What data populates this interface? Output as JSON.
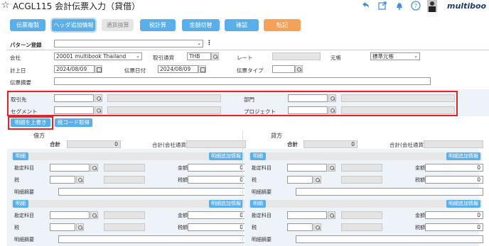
{
  "header": {
    "title": "ACGL115 会計伝票入力（貸借）",
    "logo": "multiboo"
  },
  "toolbar": {
    "buttons": [
      "伝票複製",
      "ヘッダ追加情報",
      "通貨換算",
      "税計算",
      "金額切替",
      "確認",
      "転記"
    ]
  },
  "form": {
    "pattern_label": "パターン登録",
    "company_label": "会社",
    "company_value": "20001 multibook Thailand",
    "currency_label": "取引通貨",
    "currency_value": "THB",
    "rate_label": "レート",
    "ledger_label": "元帳",
    "ledger_value": "標準元帳",
    "post_date_label": "計上日",
    "post_date_value": "2024/08/09",
    "doc_date_label": "伝票日付",
    "doc_date_value": "2024/08/09",
    "doc_type_label": "伝票タイプ",
    "summary_label": "伝票摘要"
  },
  "header_fields": {
    "partner_label": "取引先",
    "dept_label": "部門",
    "segment_label": "セグメント",
    "project_label": "プロジェクト"
  },
  "actions": {
    "overwrite": "明細を上書き",
    "tax_code": "税コード取得"
  },
  "debit": {
    "title": "借方",
    "total_label": "合計",
    "total_value": "0",
    "company_total_label": "合計(会社通貨)"
  },
  "credit": {
    "title": "貸方",
    "total_label": "合計",
    "total_value": "0",
    "company_total_label": "合計(会社通貨)"
  },
  "detail": {
    "tag": "明細",
    "extra_btn": "明細追加情報",
    "account_label": "勘定科目",
    "amount_label": "金額",
    "amount_value": "0",
    "tax_label": "税",
    "tax_amount_label": "税額",
    "tax_amount_value": "0",
    "memo_label": "明細摘要"
  }
}
